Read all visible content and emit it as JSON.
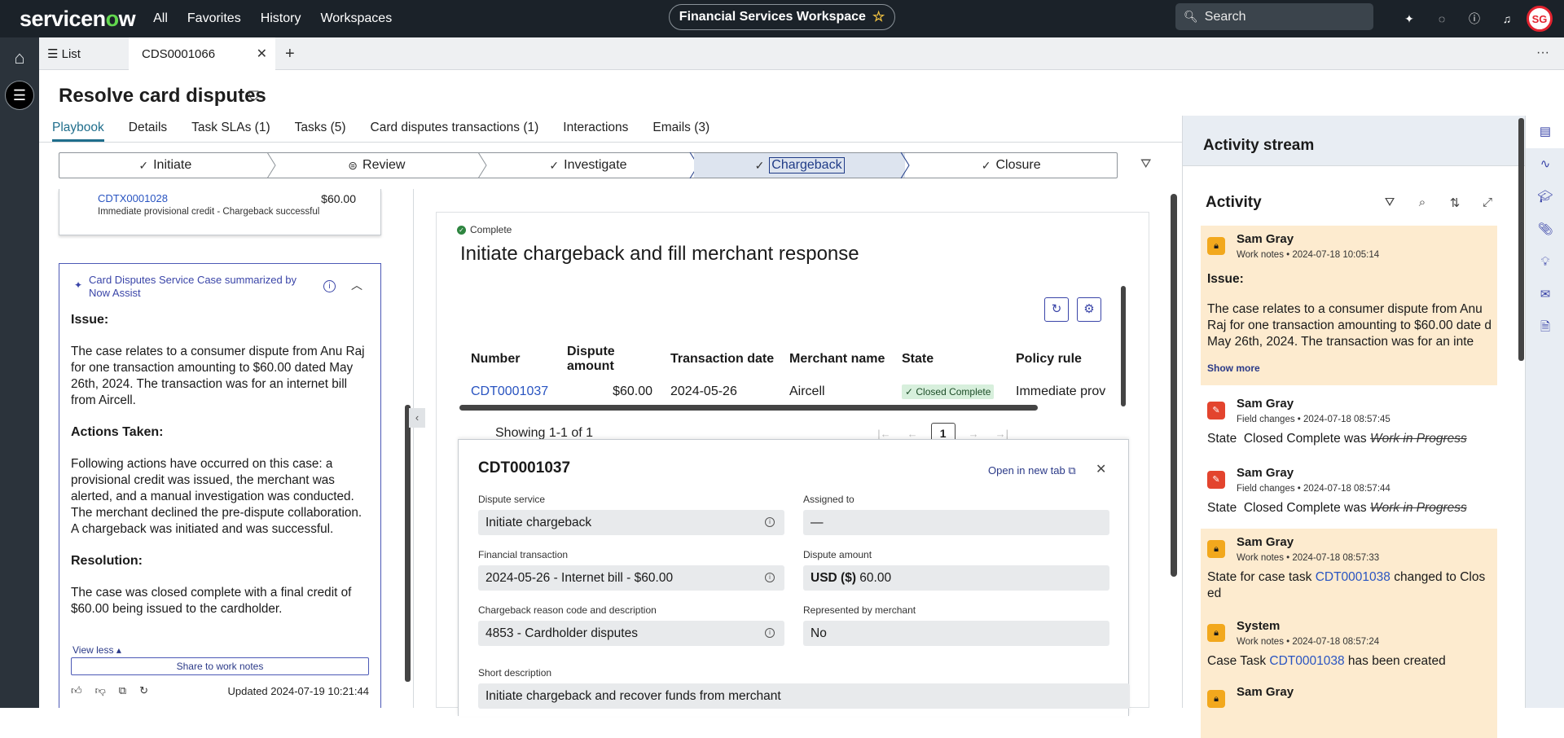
{
  "topbar": {
    "logo_pre": "servicen",
    "logo_o": "o",
    "logo_post": "w",
    "nav": [
      "All",
      "Favorites",
      "History",
      "Workspaces"
    ],
    "workspace": "Financial Services Workspace",
    "search_placeholder": "Search",
    "avatar_initials": "SG"
  },
  "tabs": {
    "list_label": "List",
    "active_label": "CDS0001066"
  },
  "page": {
    "title": "Resolve card disputes",
    "subtabs": [
      "Playbook",
      "Details",
      "Task SLAs (1)",
      "Tasks (5)",
      "Card disputes transactions (1)",
      "Interactions",
      "Emails (3)"
    ]
  },
  "stages": [
    "Initiate",
    "Review",
    "Investigate",
    "Chargeback",
    "Closure"
  ],
  "left_card": {
    "number": "CDTX0001028",
    "amount": "$60.00",
    "description": "Immediate provisional credit - Chargeback successful"
  },
  "summary": {
    "heading": "Card Disputes Service Case summarized by Now Assist",
    "issue_h": "Issue:",
    "issue_p": "The case relates to a consumer dispute from Anu Raj for one transaction amounting to $60.00 dated May 26th, 2024. The transaction was for an internet bill from Aircell.",
    "actions_h": "Actions Taken:",
    "actions_p": "Following actions have occurred on this case: a provisional credit was issued, the merchant was alerted, and a manual investigation was conducted. The merchant declined the pre-dispute collaboration. A chargeback was initiated and was successful.",
    "resolution_h": "Resolution:",
    "resolution_p": "The case was closed complete with a final credit of $60.00 being issued to the cardholder.",
    "view_less": "View less",
    "share": "Share to work notes",
    "updated": "Updated 2024-07-19 10:21:44"
  },
  "task": {
    "status": "Complete",
    "title": "Initiate chargeback and fill merchant response",
    "columns": [
      "Number",
      "Dispute amount",
      "Transaction date",
      "Merchant name",
      "State",
      "Policy rule"
    ],
    "row": {
      "number": "CDT0001037",
      "amount": "$60.00",
      "date": "2024-05-26",
      "merchant": "Aircell",
      "state": "Closed Complete",
      "policy": "Immediate prov"
    },
    "showing": "Showing 1-1 of 1",
    "page": "1"
  },
  "detail": {
    "title": "CDT0001037",
    "open_new_tab": "Open in new tab",
    "dispute_service_label": "Dispute service",
    "dispute_service": "Initiate chargeback",
    "assigned_to_label": "Assigned to",
    "assigned_to": "—",
    "financial_txn_label": "Financial transaction",
    "financial_txn": "2024-05-26 - Internet bill - $60.00",
    "dispute_amount_label": "Dispute amount",
    "dispute_amount_currency": "USD ($)",
    "dispute_amount": "60.00",
    "reason_label": "Chargeback reason code and description",
    "reason": "4853 - Cardholder disputes",
    "represented_label": "Represented by merchant",
    "represented": "No",
    "short_desc_label": "Short description",
    "short_desc": "Initiate chargeback and recover funds from merchant"
  },
  "activity": {
    "stream_title": "Activity stream",
    "title": "Activity",
    "entries": [
      {
        "who": "Sam Gray",
        "type": "Work notes",
        "time": "2024-07-18 10:05:14",
        "issue": "Issue:",
        "text": "The case relates to a consumer dispute from Anu Raj for one transaction amounting to $60.00 date d May 26th, 2024. The transaction was for an inte",
        "more": "Show more"
      },
      {
        "who": "Sam Gray",
        "type": "Field changes",
        "time": "2024-07-18 08:57:45",
        "field": "State",
        "new": "Closed Complete",
        "was": "was",
        "old": "Work in Progress"
      },
      {
        "who": "Sam Gray",
        "type": "Field changes",
        "time": "2024-07-18 08:57:44",
        "field": "State",
        "new": "Closed Complete",
        "was": "was",
        "old": "Work in Progress"
      },
      {
        "who": "Sam Gray",
        "type": "Work notes",
        "time": "2024-07-18 08:57:33",
        "pre": "State for case task ",
        "link": "CDT0001038",
        "post": " changed to Clos ed"
      },
      {
        "who": "System",
        "type": "Work notes",
        "time": "2024-07-18 08:57:24",
        "pre": "Case Task ",
        "link": "CDT0001038",
        "post": " has been created"
      },
      {
        "who": "Sam Gray"
      }
    ]
  }
}
